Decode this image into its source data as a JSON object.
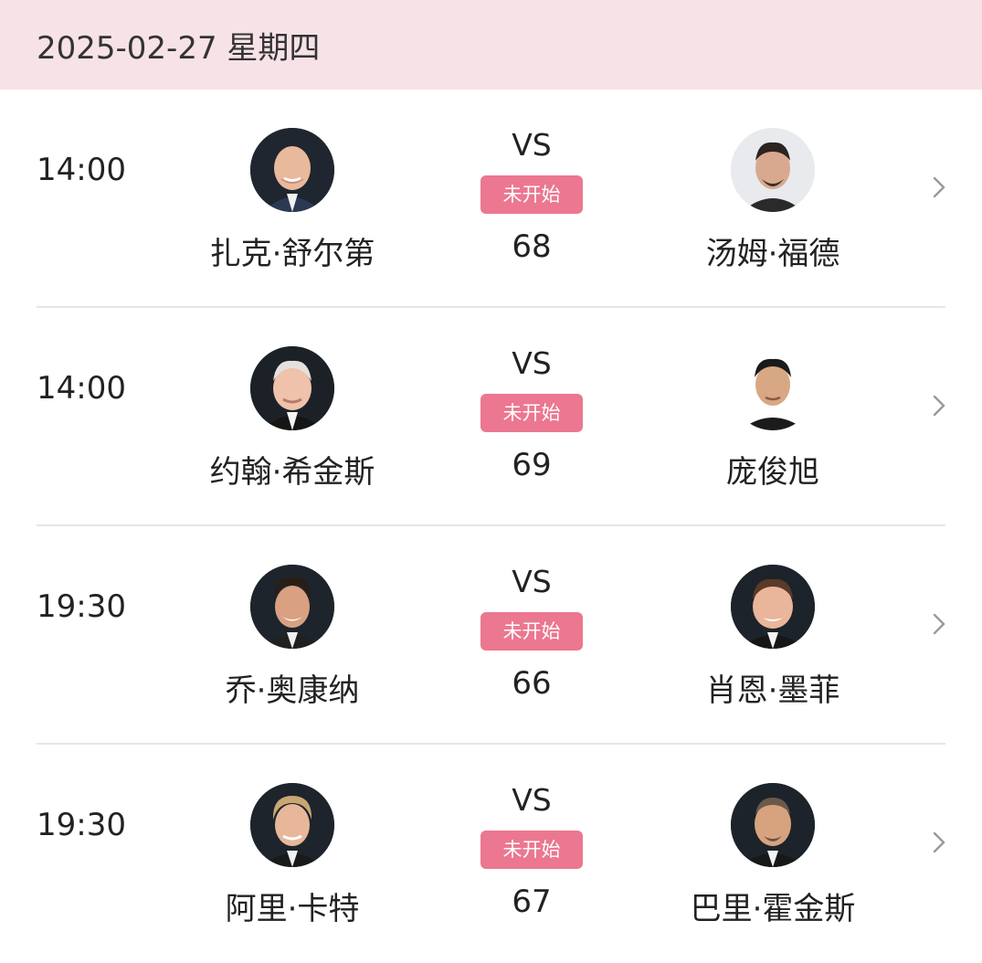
{
  "date_header": "2025-02-27 星期四",
  "matches": [
    {
      "time": "14:00",
      "player1": "扎克·舒尔第",
      "player2": "汤姆·福德",
      "vs": "VS",
      "status": "未开始",
      "round": "68"
    },
    {
      "time": "14:00",
      "player1": "约翰·希金斯",
      "player2": "庞俊旭",
      "vs": "VS",
      "status": "未开始",
      "round": "69"
    },
    {
      "time": "19:30",
      "player1": "乔·奥康纳",
      "player2": "肖恩·墨菲",
      "vs": "VS",
      "status": "未开始",
      "round": "66"
    },
    {
      "time": "19:30",
      "player1": "阿里·卡特",
      "player2": "巴里·霍金斯",
      "vs": "VS",
      "status": "未开始",
      "round": "67"
    }
  ],
  "colors": {
    "header_bg": "#f7e2e7",
    "status_bg": "#ec7790",
    "divider": "#e6e6e6"
  },
  "icons": {
    "avatar": "player-avatar-icon",
    "chevron": "chevron-right-icon"
  }
}
